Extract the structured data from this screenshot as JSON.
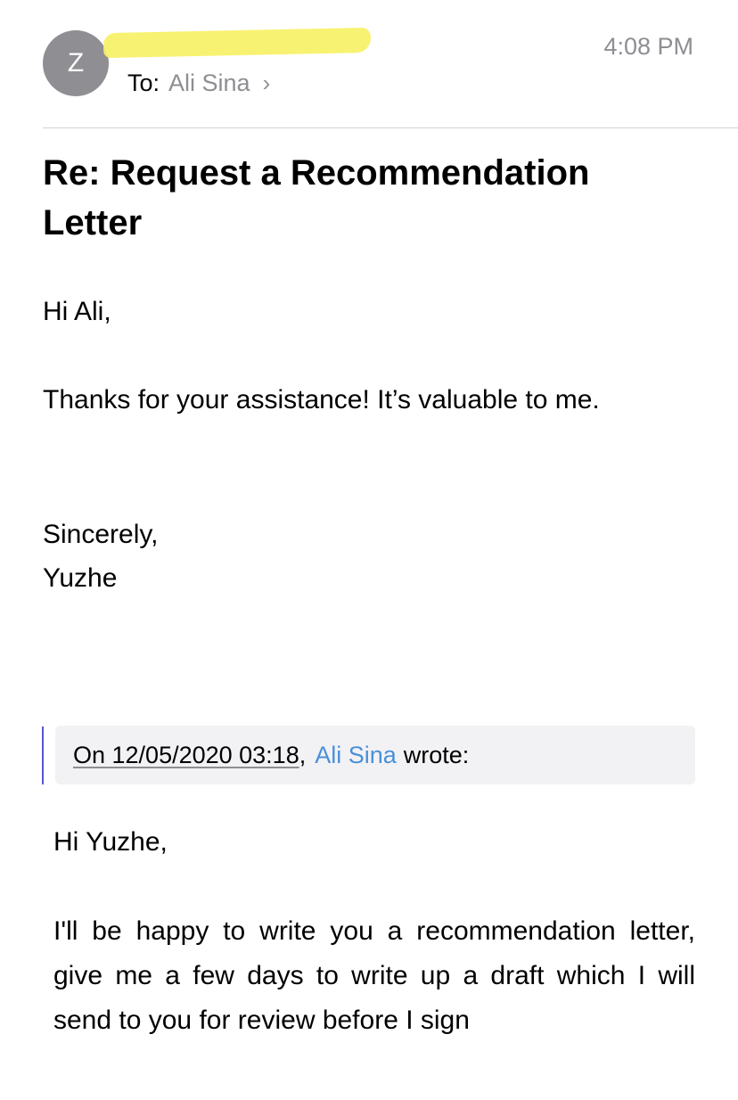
{
  "header": {
    "avatar_initial": "Z",
    "to_label": "To:",
    "recipient": "Ali Sina",
    "time": "4:08 PM"
  },
  "subject": "Re: Request a Recommendation Letter",
  "message": {
    "greeting": "Hi Ali,",
    "body": "Thanks for your assistance! It’s valuable to me.",
    "closing": "Sincerely,",
    "signature": "Yuzhe"
  },
  "quote": {
    "date": "On 12/05/2020 03:18",
    "separator": ",",
    "author": "Ali Sina",
    "wrote": "wrote:",
    "greeting": "Hi Yuzhe,",
    "body": "I'll be happy to write you a recommendation letter, give me a few days to write up a draft which I will send to you for review before I sign"
  },
  "colors": {
    "redaction": "#f8f16a",
    "link": "#4a90d9",
    "quote_bar": "#5856d6"
  }
}
